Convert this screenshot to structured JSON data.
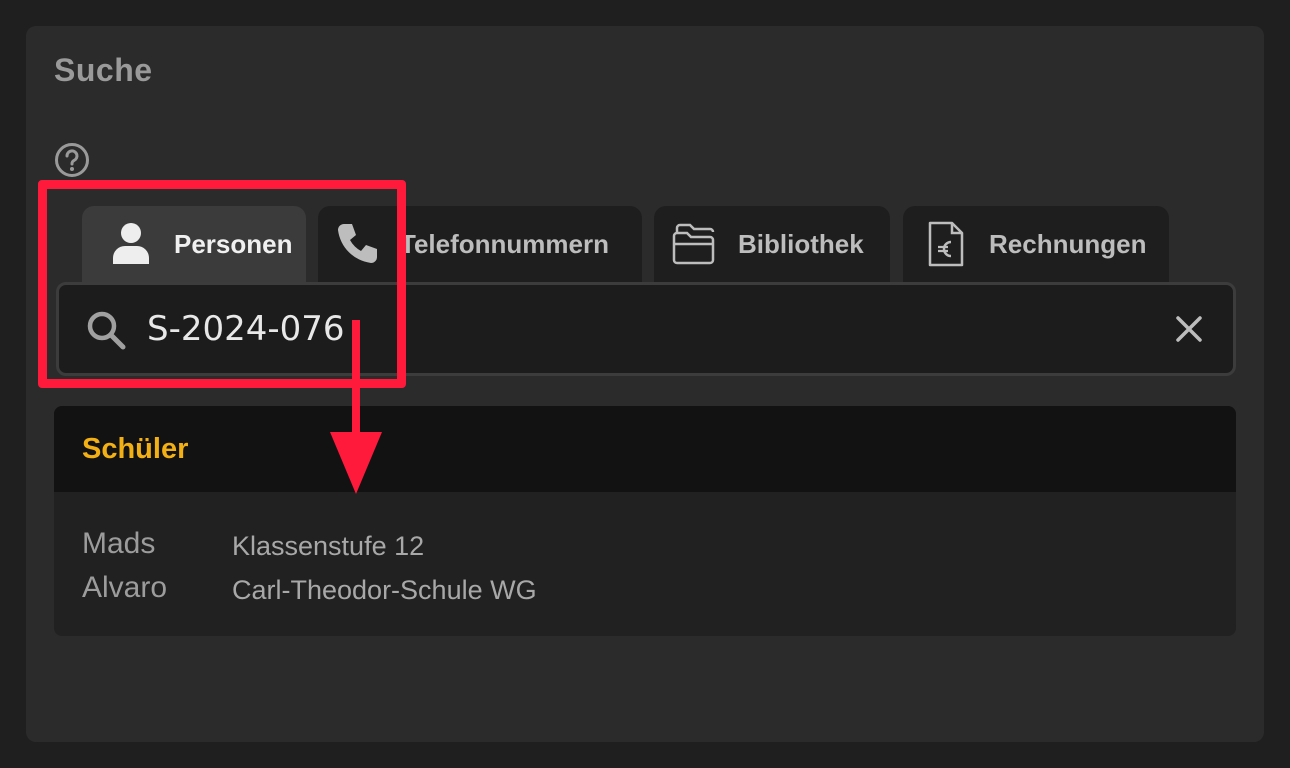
{
  "panel": {
    "title": "Suche"
  },
  "help": {
    "icon": "question-circle-icon"
  },
  "tabs": [
    {
      "label": "Personen",
      "icon": "person-icon",
      "active": true
    },
    {
      "label": "Telefonnummern",
      "icon": "phone-icon",
      "active": false
    },
    {
      "label": "Bibliothek",
      "icon": "folder-icon",
      "active": false
    },
    {
      "label": "Rechnungen",
      "icon": "euro-document-icon",
      "active": false
    }
  ],
  "search": {
    "value": "S-2024-076",
    "placeholder": "",
    "clear_icon": "close-icon"
  },
  "results": {
    "section_title": "Schüler",
    "items": [
      {
        "first_name": "Mads",
        "last_name": "Alvaro",
        "detail_line1": "Klassenstufe 12",
        "detail_line2": "Carl-Theodor-Schule WG"
      }
    ]
  },
  "annotation": {
    "color": "#ff1a3c"
  },
  "colors": {
    "accent": "#f2b014",
    "background": "#2b2b2b"
  }
}
